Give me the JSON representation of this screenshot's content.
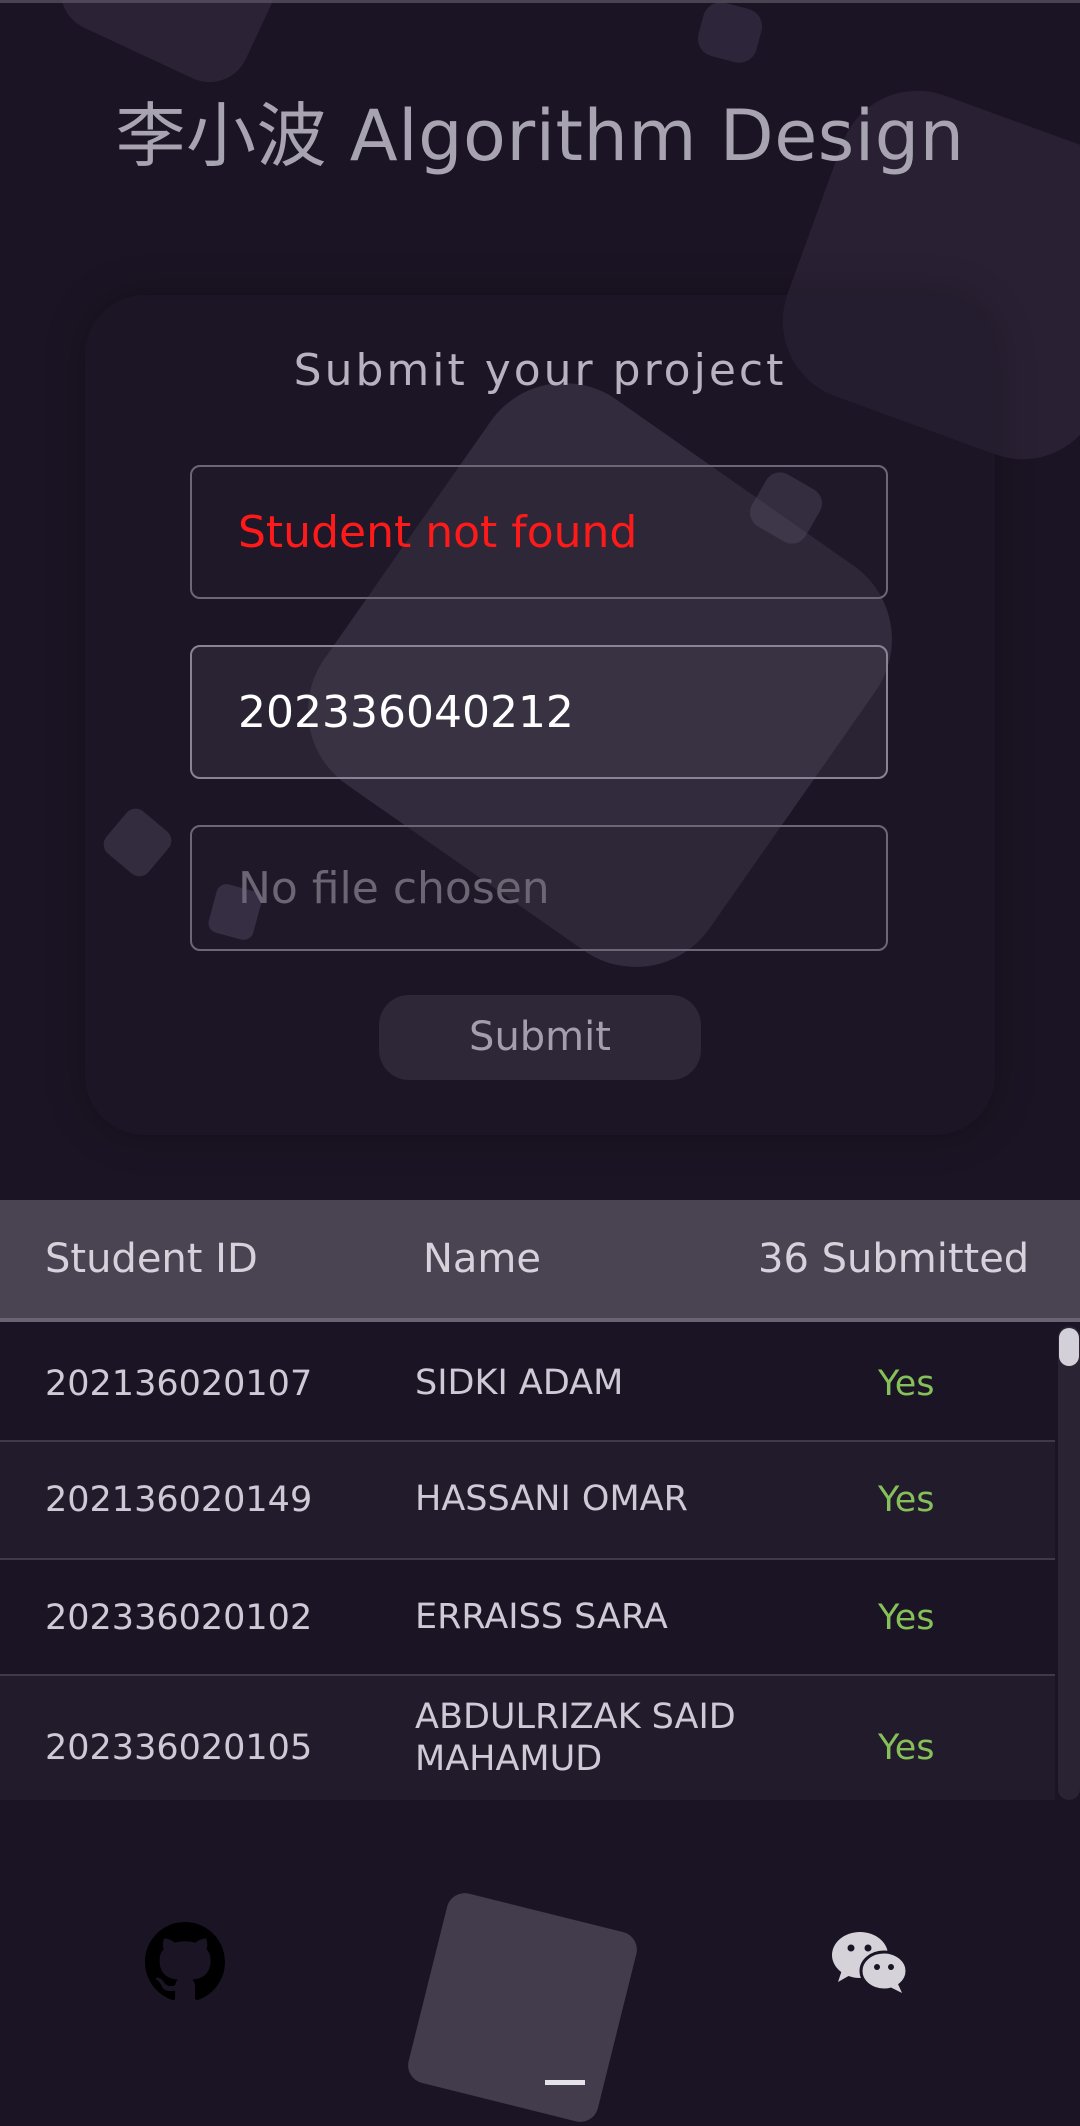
{
  "app": {
    "title": "李小波 Algorithm Design"
  },
  "form": {
    "heading": "Submit your project",
    "name_field_value": "Student not found",
    "id_field_value": "202336040212",
    "file_field_placeholder": "No file chosen",
    "submit_label": "Submit",
    "colors": {
      "error": "#ff1a1a",
      "value": "#ffffff"
    }
  },
  "table": {
    "columns": [
      "Student ID",
      "Name",
      "36 Submitted"
    ],
    "rows": [
      {
        "id": "202136020107",
        "name": "SIDKI ADAM",
        "submitted": "Yes"
      },
      {
        "id": "202136020149",
        "name": "HASSANI OMAR",
        "submitted": "Yes"
      },
      {
        "id": "202336020102",
        "name": "ERRAISS SARA",
        "submitted": "Yes"
      },
      {
        "id": "202336020105",
        "name": "ABDULRIZAK SAID MAHAMUD",
        "submitted": "Yes"
      }
    ],
    "colors": {
      "yes": "#86c058"
    }
  },
  "footer": {
    "icons": [
      "github-icon",
      "wechat-icon"
    ]
  }
}
